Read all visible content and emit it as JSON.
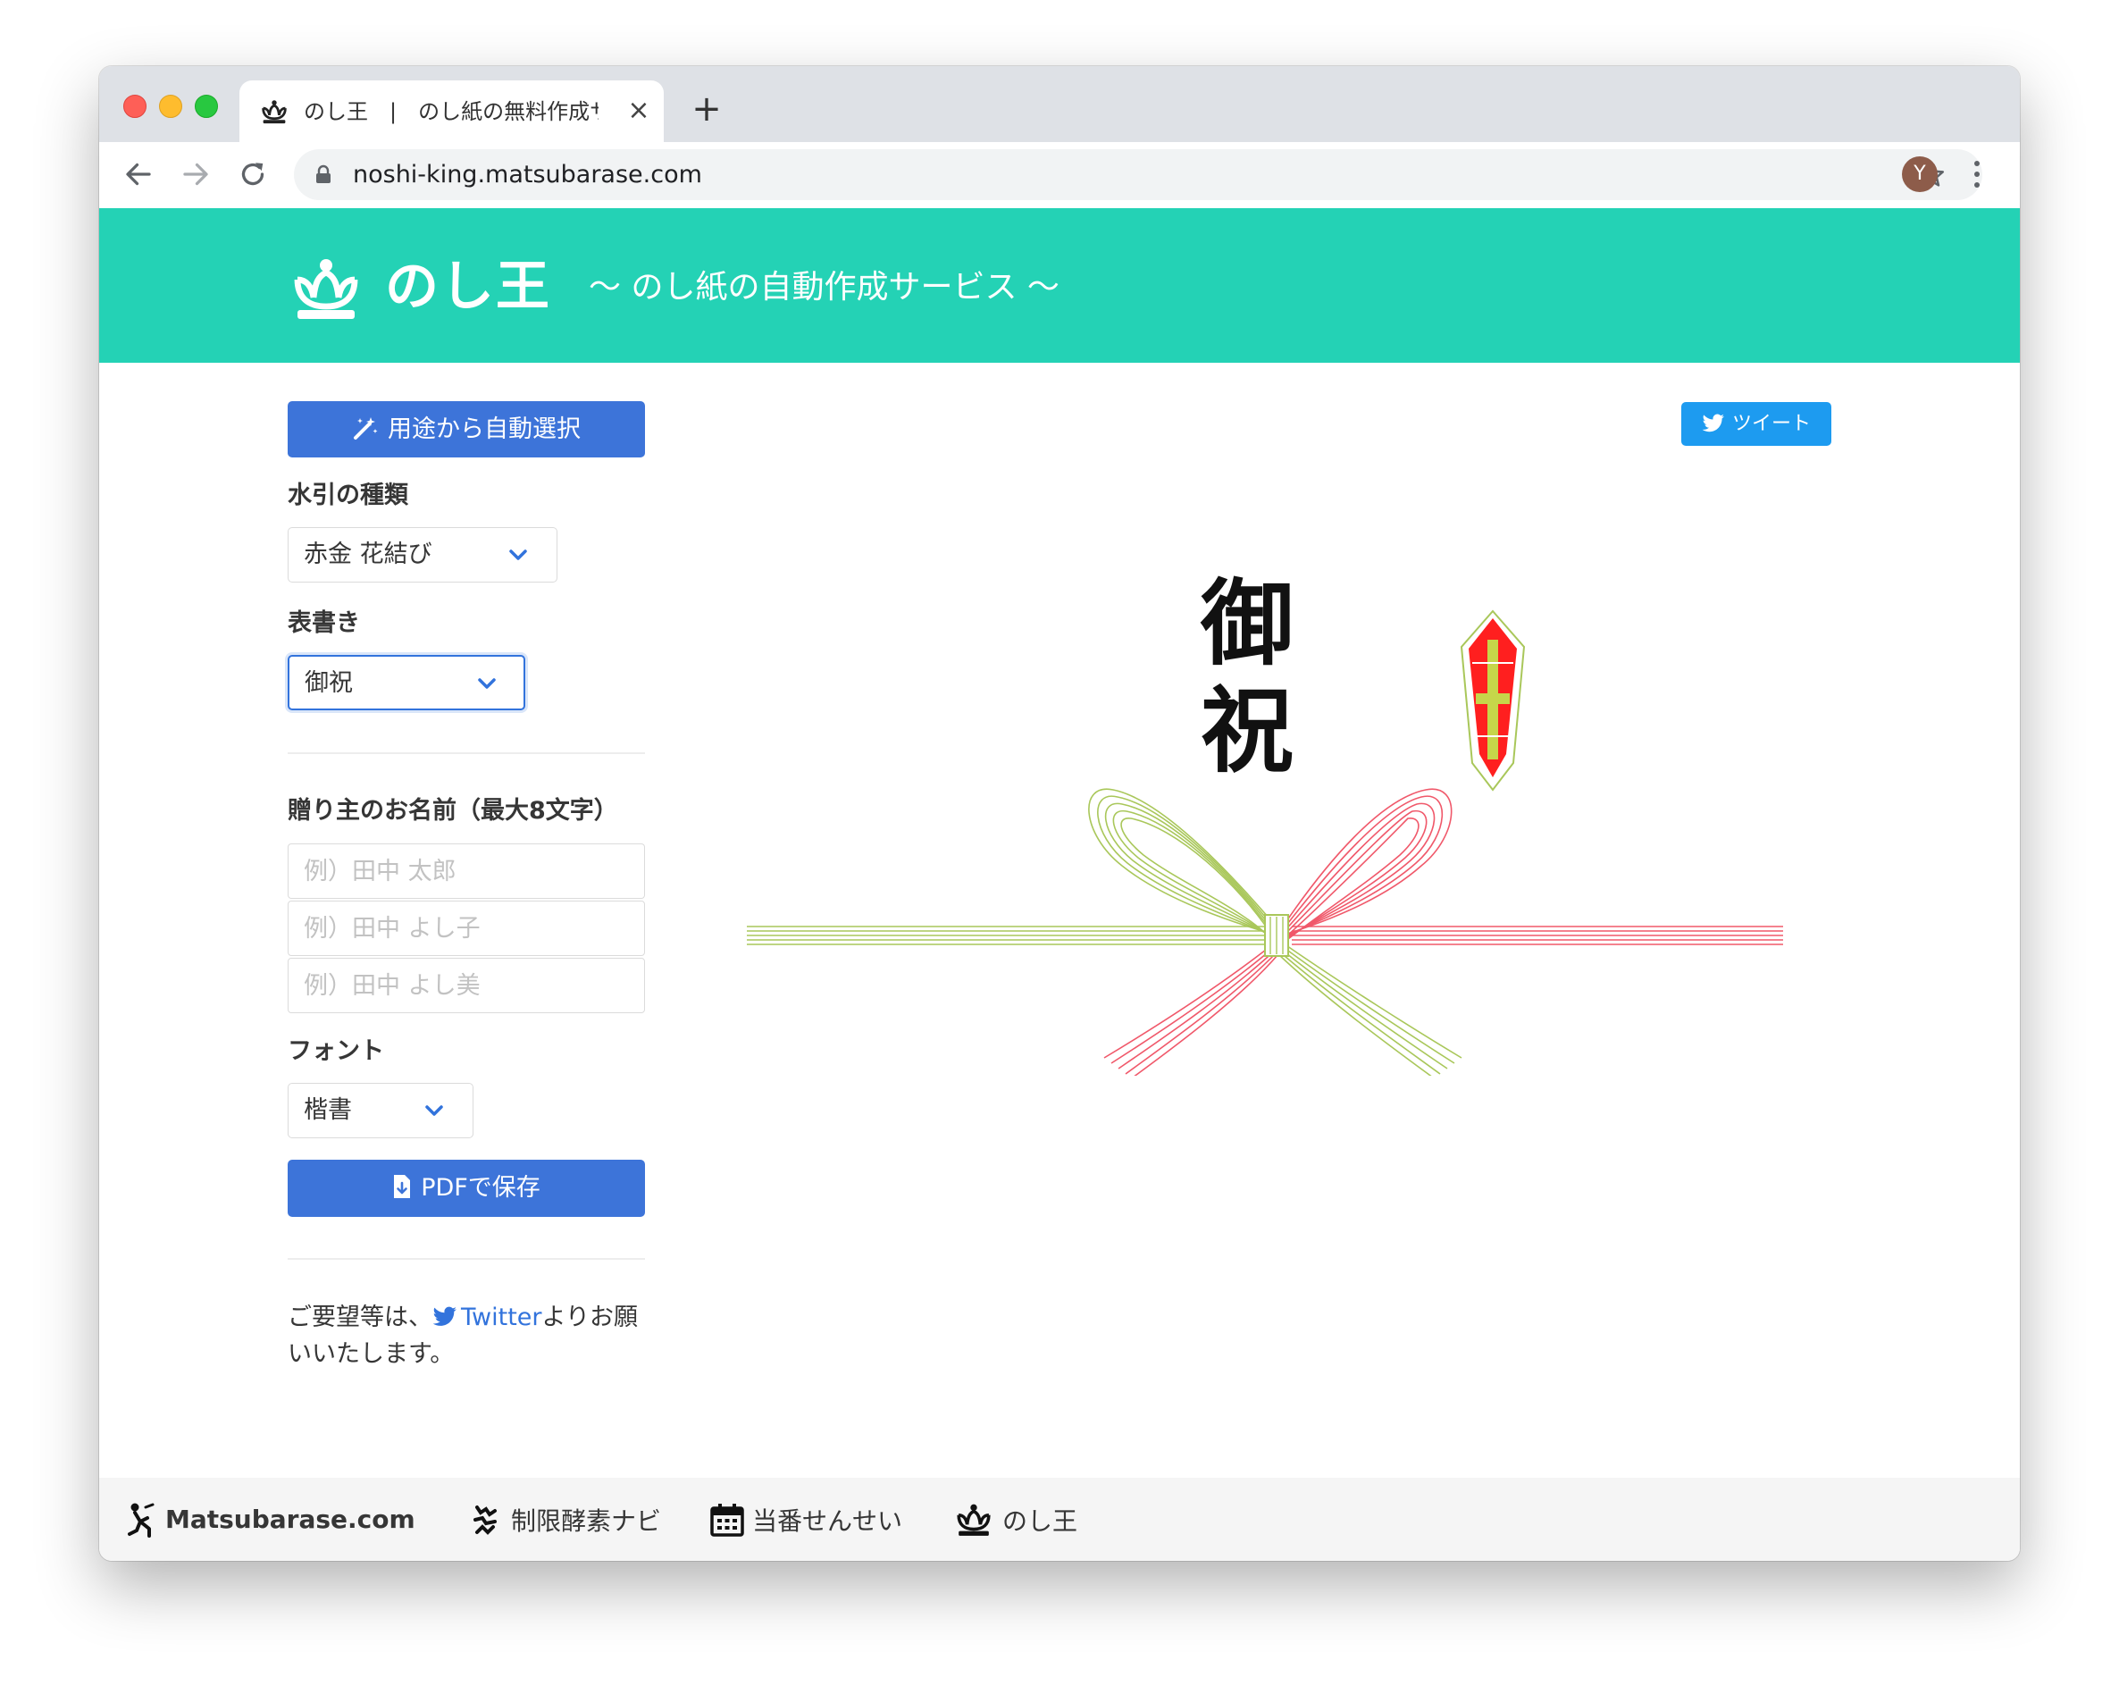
{
  "browser": {
    "tab_title": "のし王　|　のし紙の無料作成サ",
    "new_tab_label": "+",
    "close_label": "×",
    "url": "noshi-king.matsubarase.com",
    "avatar_initial": "Y"
  },
  "header": {
    "title": "のし王",
    "subtitle": "〜 のし紙の自動作成サービス 〜"
  },
  "sidebar": {
    "auto_select_label": "用途から自動選択",
    "mizuhiki_label": "水引の種類",
    "mizuhiki_value": "赤金 花結び",
    "omote_label": "表書き",
    "omote_value": "御祝",
    "names_label": "贈り主のお名前（最大8文字）",
    "name_placeholders": [
      "例）田中 太郎",
      "例）田中 よし子",
      "例）田中 よし美"
    ],
    "font_label": "フォント",
    "font_value": "楷書",
    "pdf_label": "PDFで保存",
    "contact_prefix": "ご要望等は、",
    "contact_link": "Twitter",
    "contact_suffix": "よりお願いいたします。"
  },
  "preview": {
    "tweet_label": "ツイート",
    "omote_char_1": "御",
    "omote_char_2": "祝"
  },
  "footer": {
    "items": [
      "Matsubarase.com",
      "制限酵素ナビ",
      "当番せんせい",
      "のし王"
    ]
  },
  "colors": {
    "brand": "#24d2b5",
    "primary": "#3d74d9",
    "twitter": "#1d9bf0",
    "mizuhiki_red": "#f0586a",
    "mizuhiki_gold": "#a9c75a"
  }
}
